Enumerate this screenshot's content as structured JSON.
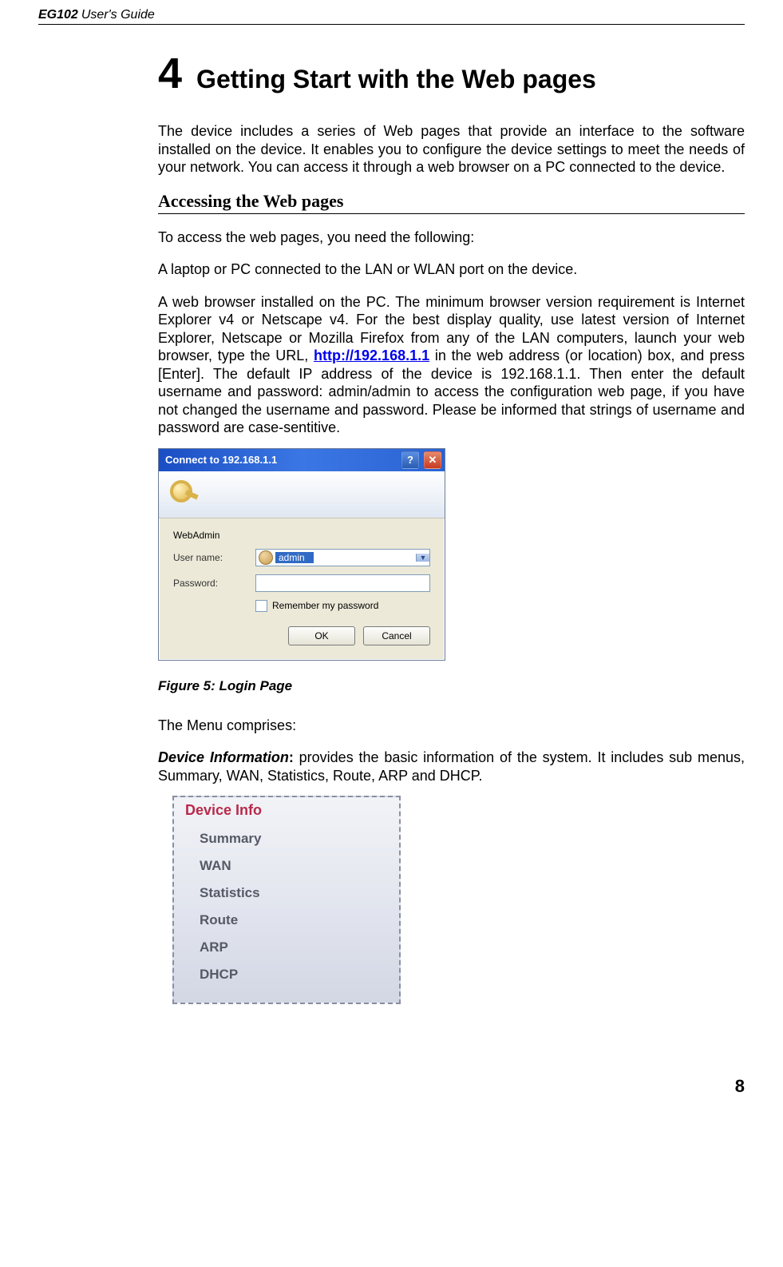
{
  "header": {
    "product": "EG102",
    "guide": "User's Guide"
  },
  "chapter": {
    "number": "4",
    "title": "Getting Start with the Web pages"
  },
  "intro": "The device includes a series of Web pages that provide an interface to the software installed on the device. It enables you to configure the device settings to meet the needs of your network. You can access it through a web browser on a PC connected to the device.",
  "section_heading": "Accessing the Web pages",
  "access_1": "To access the web pages, you need the following:",
  "access_2": "A laptop or PC connected to the LAN or WLAN port on the device.",
  "access_3a": "A web browser installed on the PC. The minimum browser version requirement is Internet Explorer v4 or Netscape v4. For the best display quality, use latest version of Internet Explorer, Netscape or Mozilla Firefox  from any of the LAN computers, launch your web browser, type the URL, ",
  "access_url": "http://192.168.1.1",
  "access_3b": " in the web address (or location) box, and press [Enter]. The default IP address of the device is 192.168.1.1. Then enter the default username and password: admin/admin to access the configuration web page, if you have not changed the username and password. Please be informed that strings of username and password are case-sentitive.",
  "login_dialog": {
    "title": "Connect to 192.168.1.1",
    "realm": "WebAdmin",
    "user_label": "User name:",
    "pass_label": "Password:",
    "user_value": "admin",
    "remember": "Remember my password",
    "ok": "OK",
    "cancel": "Cancel"
  },
  "figure_caption": "Figure 5: Login Page",
  "menu_intro": "The Menu comprises:",
  "devinfo_label": "Device Information",
  "devinfo_text": ": provides the basic information of the system. It includes sub menus, Summary, WAN, Statistics, Route, ARP and DHCP.",
  "devinfo_menu": {
    "title": "Device Info",
    "items": [
      "Summary",
      "WAN",
      "Statistics",
      "Route",
      "ARP",
      "DHCP"
    ]
  },
  "page_number": "8"
}
